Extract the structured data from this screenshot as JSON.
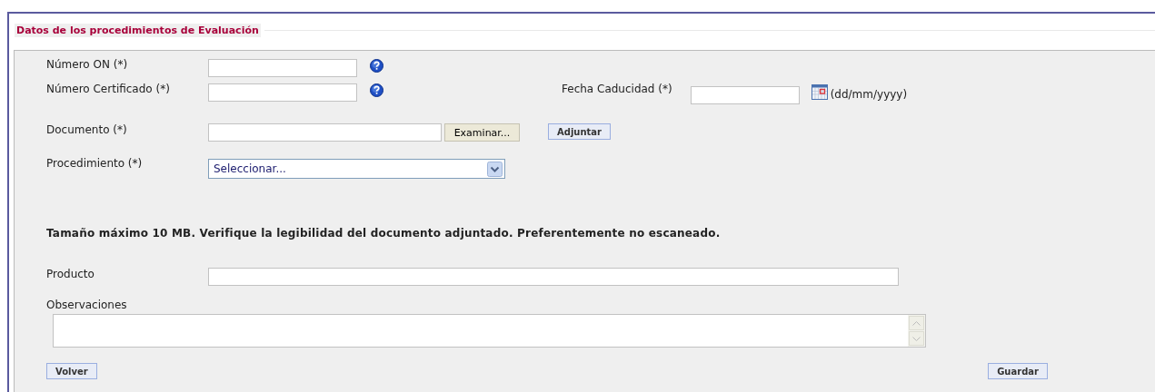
{
  "section": {
    "title": "Datos de los procedimientos de Evaluación"
  },
  "numero_on": {
    "label": "Número ON (*)"
  },
  "numero_certificado": {
    "label": "Número Certificado (*)"
  },
  "fecha_caducidad": {
    "label": "Fecha Caducidad (*)",
    "format_hint": "(dd/mm/yyyy)"
  },
  "documento": {
    "label": "Documento (*)",
    "browse_button": "Examinar...",
    "attach_button": "Adjuntar"
  },
  "procedimiento": {
    "label": "Procedimiento (*)",
    "value": "Seleccionar..."
  },
  "note": "Tamaño máximo 10 MB. Verifique la legibilidad del documento adjuntado. Preferentemente no escaneado.",
  "producto": {
    "label": "Producto"
  },
  "observaciones": {
    "label": "Observaciones"
  },
  "buttons": {
    "back": "Volver",
    "save": "Guardar"
  }
}
